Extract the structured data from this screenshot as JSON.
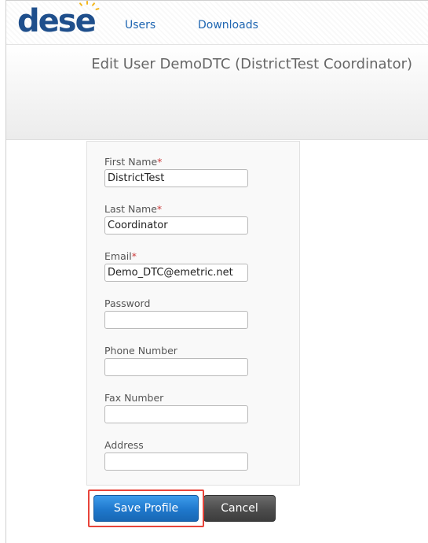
{
  "header": {
    "logo_text": "dese",
    "nav": [
      {
        "label": "Users"
      },
      {
        "label": "Downloads"
      }
    ]
  },
  "page": {
    "title": "Edit User DemoDTC (DistrictTest Coordinator)"
  },
  "form": {
    "required_marker": "*",
    "fields": [
      {
        "label": "First Name",
        "required": true,
        "value": "DistrictTest"
      },
      {
        "label": "Last Name",
        "required": true,
        "value": "Coordinator"
      },
      {
        "label": "Email",
        "required": true,
        "value": "Demo_DTC@emetric.net"
      },
      {
        "label": "Password",
        "required": false,
        "value": ""
      },
      {
        "label": "Phone Number",
        "required": false,
        "value": ""
      },
      {
        "label": "Fax Number",
        "required": false,
        "value": ""
      },
      {
        "label": "Address",
        "required": false,
        "value": ""
      }
    ]
  },
  "actions": {
    "save_label": "Save Profile",
    "cancel_label": "Cancel"
  },
  "colors": {
    "logo": "#1f4f8c",
    "logo_sun": "#f2b51a",
    "link": "#1f66b2",
    "required": "#cc3b3b",
    "save_button": "#1f78cc",
    "cancel_button": "#4c4c4c",
    "highlight": "#e8443a"
  }
}
